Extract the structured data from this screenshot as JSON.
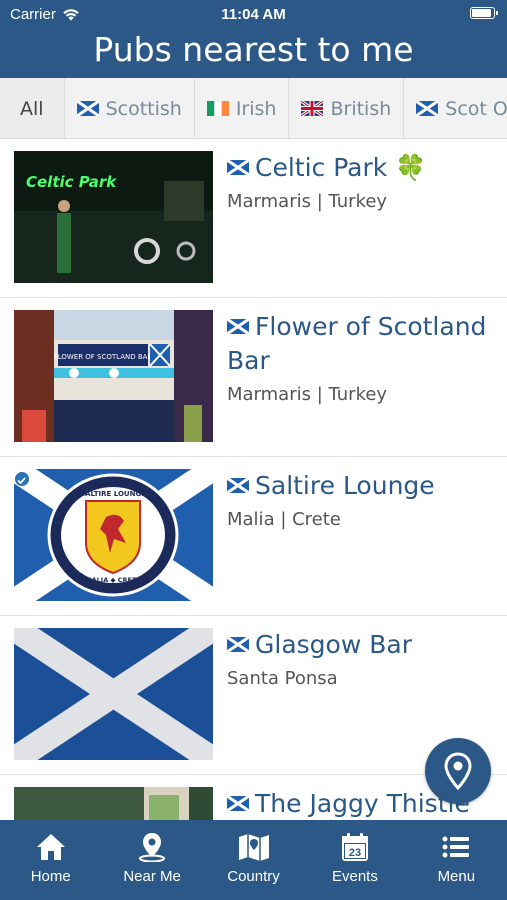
{
  "status_bar": {
    "carrier": "Carrier",
    "time": "11:04 AM"
  },
  "header": {
    "title": "Pubs nearest to me"
  },
  "filters": [
    {
      "label": "All",
      "flag": ""
    },
    {
      "label": "Scottish",
      "flag": "saltire-flag-icon"
    },
    {
      "label": "Irish",
      "flag": "irish-flag-icon"
    },
    {
      "label": "British",
      "flag": "union-jack-icon"
    },
    {
      "label": "Scot Owne",
      "flag": "saltire-flag-icon"
    }
  ],
  "pubs": [
    {
      "name": "Celtic Park",
      "emoji": "🍀",
      "location": "Marmaris | Turkey",
      "flag": "saltire-flag-icon"
    },
    {
      "name": "Flower of Scotland Bar",
      "location": "Marmaris | Turkey",
      "flag": "saltire-flag-icon"
    },
    {
      "name": "Saltire Lounge",
      "location": "Malia | Crete",
      "flag": "saltire-flag-icon",
      "selected": true
    },
    {
      "name": "Glasgow Bar",
      "location": "Santa Ponsa",
      "flag": "saltire-flag-icon"
    },
    {
      "name": "The Jaggy Thistle",
      "location": "",
      "flag": "saltire-flag-icon"
    }
  ],
  "thumb_text": {
    "celtic": "Celtic Park",
    "flower_sign": "FLOWER OF SCOTLAND BAR",
    "badge_top": "SALTIRE LOUNGE",
    "badge_bottom": "MALIA ◆ CRETE"
  },
  "nav": [
    {
      "label": "Home",
      "icon": "home-icon"
    },
    {
      "label": "Near Me",
      "icon": "location-pin-icon"
    },
    {
      "label": "Country",
      "icon": "map-icon"
    },
    {
      "label": "Events",
      "icon": "calendar-icon",
      "calendar_day": "23"
    },
    {
      "label": "Menu",
      "icon": "menu-list-icon"
    }
  ],
  "colors": {
    "brand": "#2b5886",
    "accent_blue": "#2b72b8",
    "saltire": "#1f5fae",
    "irish_green": "#169b62",
    "irish_orange": "#ff883e"
  }
}
